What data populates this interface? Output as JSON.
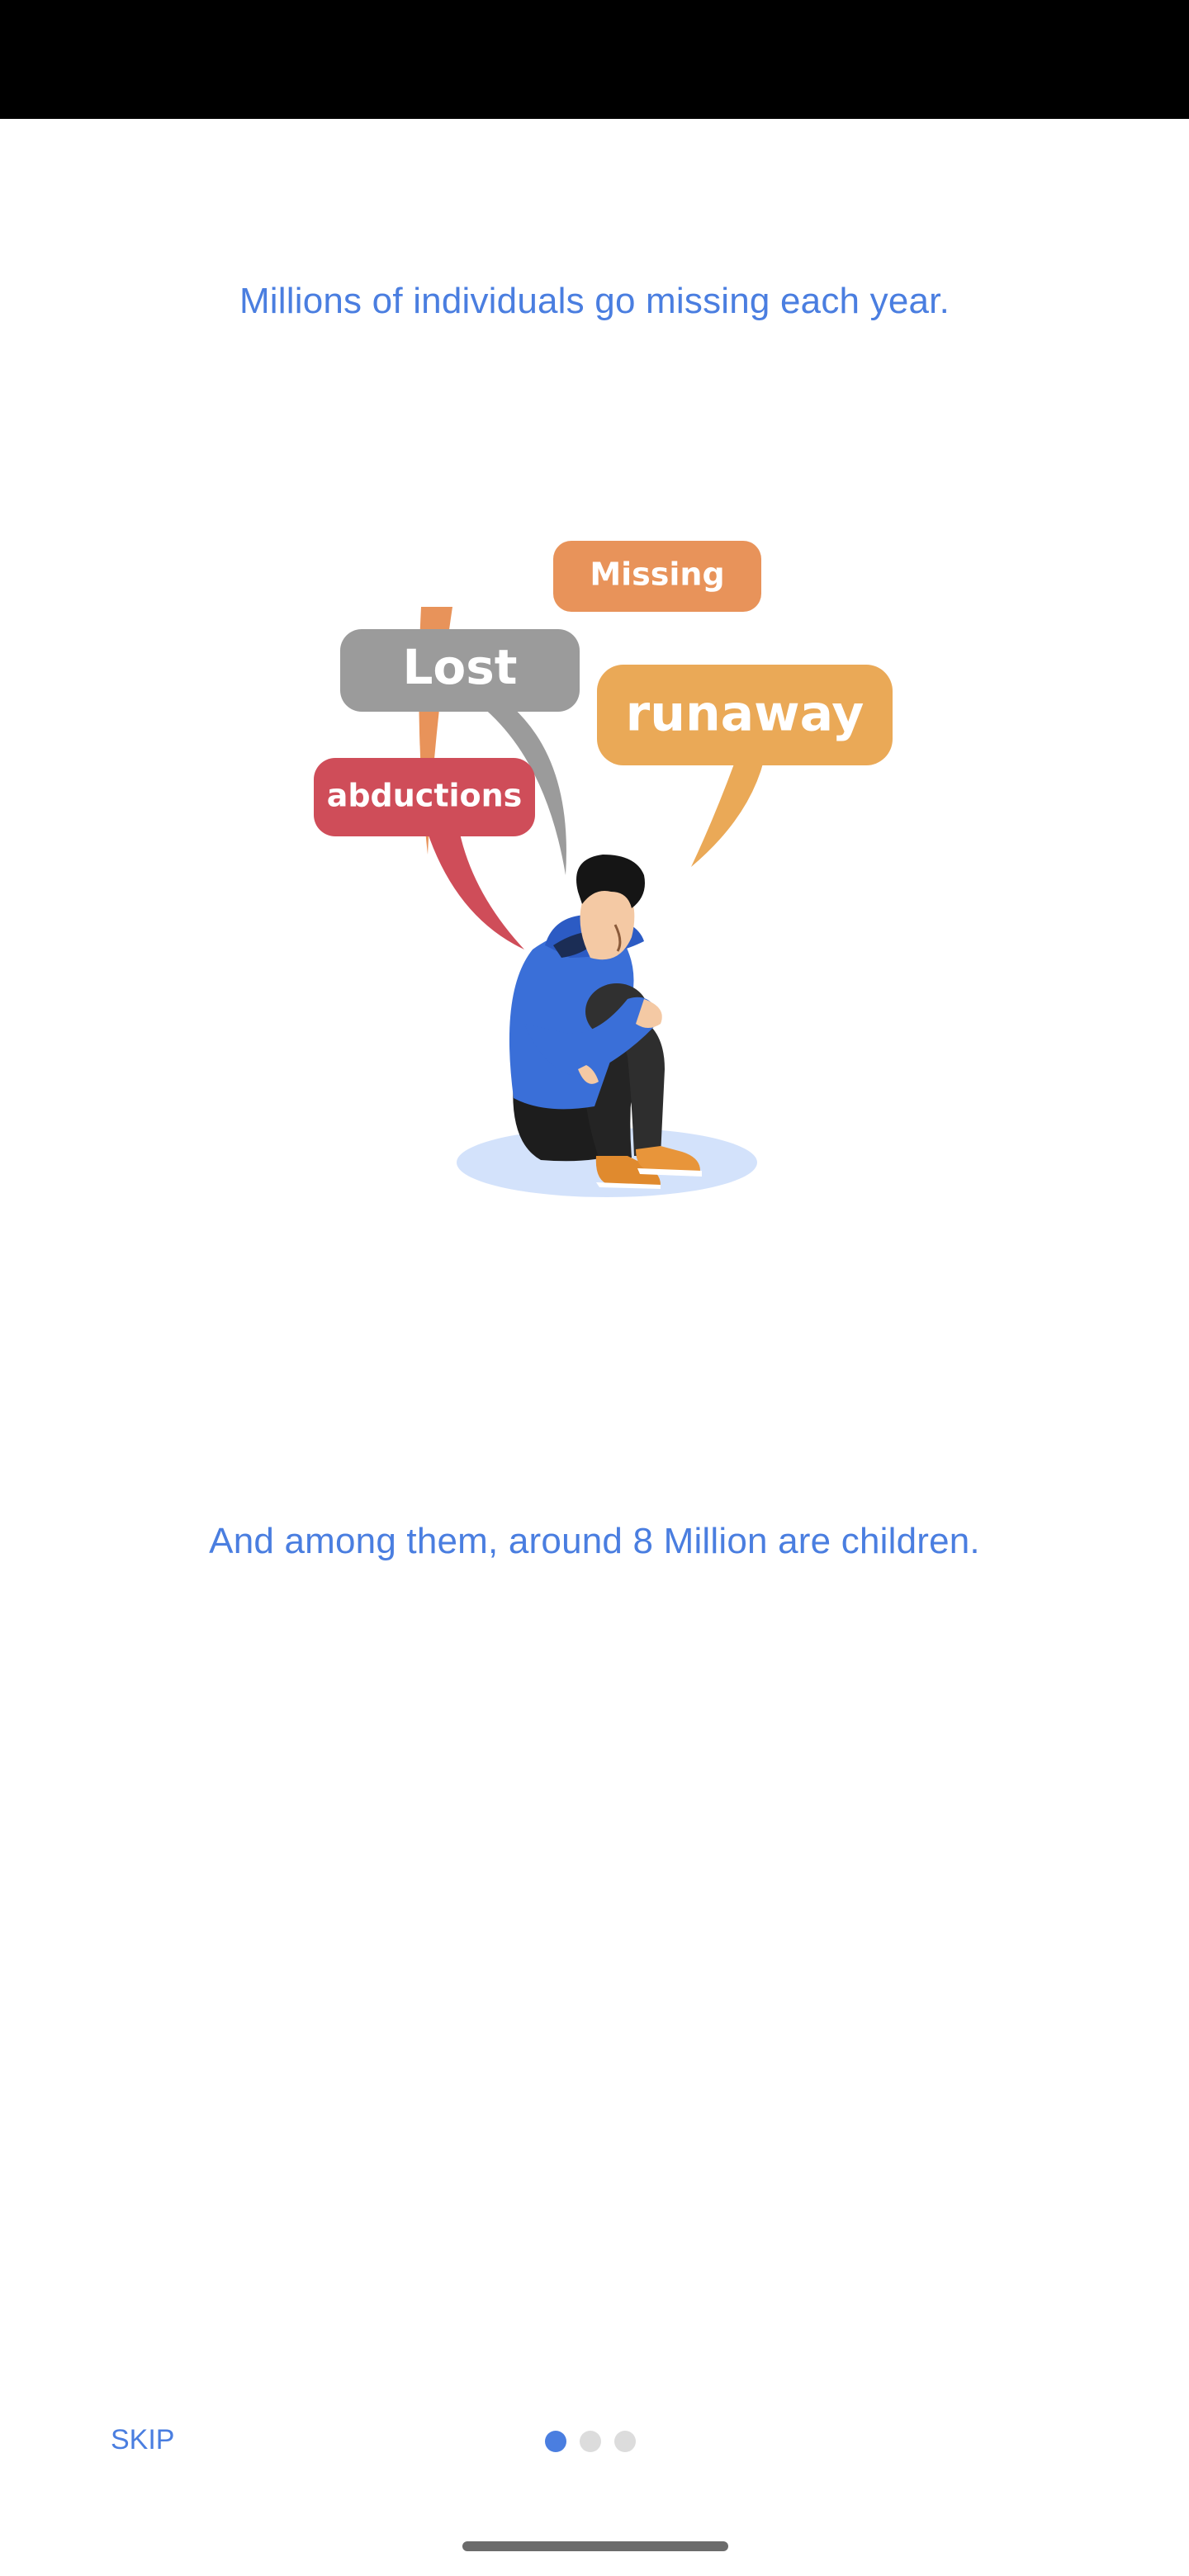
{
  "theme": {
    "accent": "#4a7ee0",
    "dot_active": "#4a7ee0",
    "dot_inactive": "#dcdcdc"
  },
  "onboarding": {
    "headline_top": "Millions of individuals go missing each year.",
    "headline_bottom": "And among them, around 8 Million are children.",
    "illustration": {
      "bubbles": {
        "missing": "Missing",
        "lost": "Lost",
        "runaway": "runaway",
        "abductions": "abductions"
      },
      "bubble_colors": {
        "missing": "#e8935a",
        "lost": "#9b9b9b",
        "runaway": "#eaa957",
        "abductions": "#cf4d59"
      }
    },
    "skip_label": "SKIP",
    "pager": {
      "pages": 3,
      "current": 1
    }
  }
}
